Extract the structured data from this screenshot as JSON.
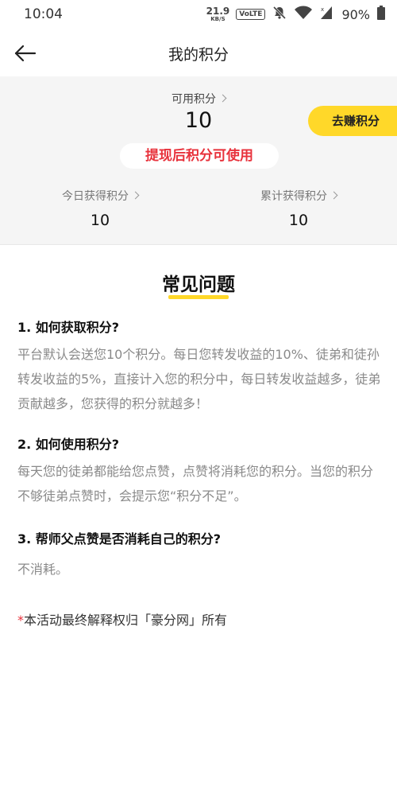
{
  "status_bar": {
    "time": "10:04",
    "net_speed_value": "21.9",
    "net_speed_unit": "KB/S",
    "volte_badge": "VoLTE",
    "battery_percent": "90%",
    "icons": [
      "mute-icon",
      "wifi-icon",
      "signal-icon",
      "battery-icon"
    ]
  },
  "nav": {
    "title": "我的积分",
    "back_icon": "back-arrow-icon"
  },
  "points": {
    "available_label": "可用积分",
    "available_value": "10",
    "earn_button": "去赚积分",
    "withdraw_notice": "提现后积分可使用",
    "today_label": "今日获得积分",
    "today_value": "10",
    "total_label": "累计获得积分",
    "total_value": "10"
  },
  "faq": {
    "title": "常见问题",
    "items": [
      {
        "question": "1. 如何获取积分?",
        "answer": "平台默认会送您10个积分。每日您转发收益的10%、徒弟和徒孙转发收益的5%，直接计入您的积分中，每日转发收益越多，徒弟贡献越多，您获得的积分就越多！"
      },
      {
        "question": "2. 如何使用积分?",
        "answer": "每天您的徒弟都能给您点赞，点赞将消耗您的积分。当您的积分不够徒弟点赞时，会提示您“积分不足”。"
      },
      {
        "question": "3. 帮师父点赞是否消耗自己的积分?",
        "answer": "不消耗。"
      }
    ],
    "note_star": "*",
    "note_text": "本活动最终解释权归「豪分网」所有"
  },
  "colors": {
    "accent_yellow": "#ffd829",
    "alert_red": "#e8323c",
    "panel_bg": "#f5f5f5"
  }
}
